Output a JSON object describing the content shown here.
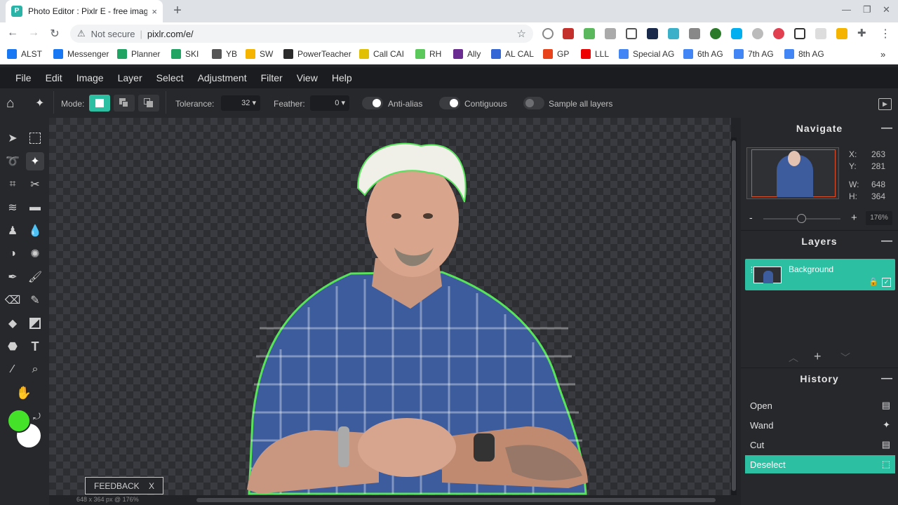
{
  "browser": {
    "tab_title": "Photo Editor : Pixlr E - free image",
    "tab_close": "×",
    "new_tab": "+",
    "not_secure": "Not secure",
    "url": "pixlr.com/e/",
    "bookmarks": [
      {
        "label": "ALST",
        "color": "#1877f2"
      },
      {
        "label": "Messenger",
        "color": "#1877f2"
      },
      {
        "label": "Planner",
        "color": "#1fa463"
      },
      {
        "label": "SKI",
        "color": "#1fa463"
      },
      {
        "label": "YB",
        "color": "#555"
      },
      {
        "label": "SW",
        "color": "#f4b400"
      },
      {
        "label": "PowerTeacher",
        "color": "#2b2b2b"
      },
      {
        "label": "Call CAI",
        "color": "#e0c000"
      },
      {
        "label": "RH",
        "color": "#5ac85a"
      },
      {
        "label": "Ally",
        "color": "#6b2c91"
      },
      {
        "label": "AL CAL",
        "color": "#3367d6"
      },
      {
        "label": "GP",
        "color": "#e8431a"
      },
      {
        "label": "LLL",
        "color": "#e00"
      },
      {
        "label": "Special AG",
        "color": "#4285f4"
      },
      {
        "label": "6th AG",
        "color": "#4285f4"
      },
      {
        "label": "7th AG",
        "color": "#4285f4"
      },
      {
        "label": "8th AG",
        "color": "#4285f4"
      }
    ],
    "more_bookmarks": "»"
  },
  "menu": [
    "File",
    "Edit",
    "Image",
    "Layer",
    "Select",
    "Adjustment",
    "Filter",
    "View",
    "Help"
  ],
  "options": {
    "mode_label": "Mode:",
    "tolerance_label": "Tolerance:",
    "tolerance_value": "32",
    "feather_label": "Feather:",
    "feather_value": "0",
    "anti_alias": "Anti-alias",
    "anti_alias_on": true,
    "contiguous": "Contiguous",
    "contiguous_on": true,
    "sample_all": "Sample all layers",
    "sample_all_on": false
  },
  "colors": {
    "accent": "#2cbfa2",
    "primary": "#45e22a",
    "secondary": "#ffffff"
  },
  "canvas": {
    "feedback": "FEEDBACK",
    "feedback_close": "X",
    "status": "648 x 364 px @ 176%"
  },
  "navigate": {
    "title": "Navigate",
    "x_label": "X:",
    "x": "263",
    "y_label": "Y:",
    "y": "281",
    "w_label": "W:",
    "w": "648",
    "h_label": "H:",
    "h": "364",
    "zoom_minus": "-",
    "zoom_plus": "+",
    "zoom": "176%"
  },
  "layers": {
    "title": "Layers",
    "items": [
      {
        "name": "Background"
      }
    ]
  },
  "history": {
    "title": "History",
    "items": [
      {
        "label": "Open",
        "icon": "document-icon"
      },
      {
        "label": "Wand",
        "icon": "wand-icon"
      },
      {
        "label": "Cut",
        "icon": "document-icon"
      },
      {
        "label": "Deselect",
        "icon": "select-icon",
        "active": true
      }
    ]
  }
}
